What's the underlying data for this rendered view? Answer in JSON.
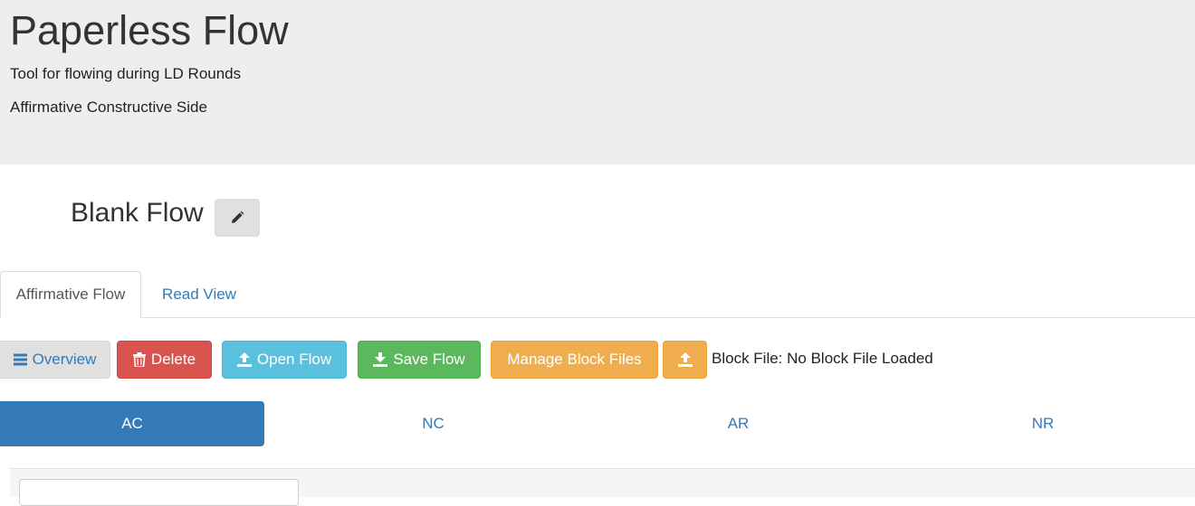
{
  "header": {
    "title": "Paperless Flow",
    "subtitle": "Tool for flowing during LD Rounds",
    "side": "Affirmative Constructive Side"
  },
  "flow": {
    "title": "Blank Flow",
    "edit_icon": "pencil-icon"
  },
  "tabs": [
    {
      "label": "Affirmative Flow",
      "active": true
    },
    {
      "label": "Read View",
      "active": false
    }
  ],
  "toolbar": {
    "overview_label": "Overview",
    "delete_label": "Delete",
    "open_label": "Open Flow",
    "save_label": "Save Flow",
    "manage_label": "Manage Block Files",
    "block_file_status": "Block File: No Block File Loaded",
    "icons": {
      "overview": "list-icon",
      "delete": "trash-icon",
      "open": "upload-icon",
      "save": "download-icon",
      "upload_block": "upload-icon"
    }
  },
  "speeches": [
    {
      "label": "AC",
      "active": true
    },
    {
      "label": "NC",
      "active": false
    },
    {
      "label": "AR",
      "active": false
    },
    {
      "label": "NR",
      "active": false
    }
  ],
  "colors": {
    "primary": "#337ab7",
    "danger": "#d9534f",
    "info": "#5bc0de",
    "success": "#5cb85c",
    "warning": "#f0ad4e",
    "jumbotron": "#eeeeee"
  }
}
